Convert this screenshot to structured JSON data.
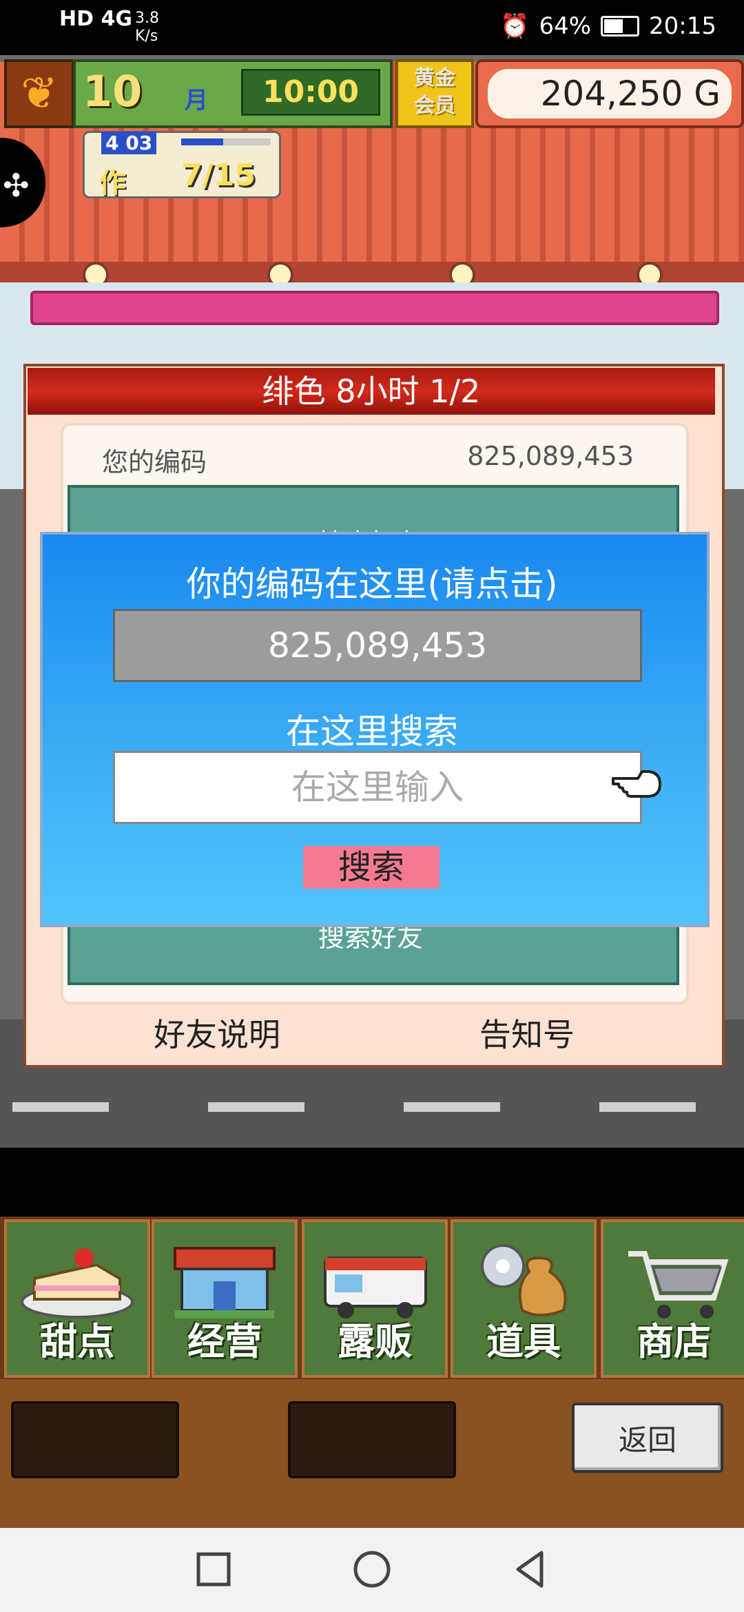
{
  "status_bar": {
    "network": "HD 4G",
    "speed": "3.8\nK/s",
    "battery": "64%",
    "battery_level": 0.64,
    "time": "20:15"
  },
  "hud": {
    "month_number": "10",
    "month_label": "月",
    "time": "10:00",
    "gold_member": "黄金会员",
    "money": "204,250 G",
    "progress_top": "4 03",
    "progress_label": "作",
    "progress_count": "7/15",
    "progress_fraction": 0.47
  },
  "panel": {
    "title": "绯色  8小时 1/2",
    "my_code_label": "您的编码",
    "my_code_value": "825,089,453",
    "green_hidden": "搜索好友",
    "green_bottom": "搜索好友",
    "friends_help": "好友说明",
    "notice": "告知号"
  },
  "overlay": {
    "title": "你的编码在这里(请点击)",
    "code": "825,089,453",
    "search_label": "在这里搜索",
    "input_placeholder": "在这里输入",
    "search_button": "搜索"
  },
  "menu": {
    "items": [
      {
        "label": "甜点",
        "icon": "cake-icon"
      },
      {
        "label": "经营",
        "icon": "shop-icon"
      },
      {
        "label": "露贩",
        "icon": "food-truck-icon"
      },
      {
        "label": "道具",
        "icon": "items-bag-icon"
      },
      {
        "label": "商店",
        "icon": "shopping-cart-icon"
      }
    ],
    "back_button": "返回"
  },
  "colors": {
    "panel_title_red": "#c0281a",
    "overlay_blue": "#2a9cf4",
    "search_pink": "#f47a92",
    "menu_green": "#4f7a3b"
  }
}
